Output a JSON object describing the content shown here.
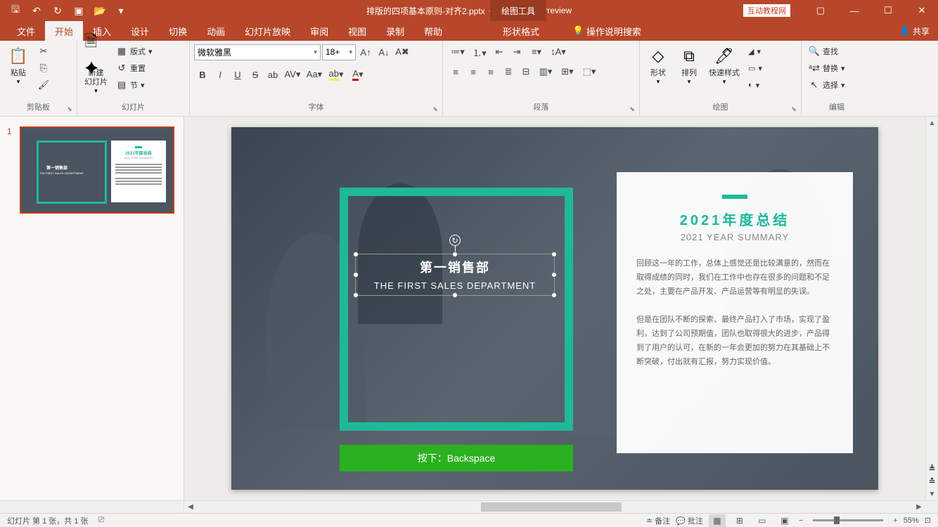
{
  "app": {
    "filename": "排版的四项基本原则-对齐2.pptx",
    "appname": "PowerPoint Preview",
    "context_tool": "绘图工具",
    "badge": "互动教程网"
  },
  "tabs": {
    "file": "文件",
    "home": "开始",
    "insert": "插入",
    "design": "设计",
    "transitions": "切换",
    "animations": "动画",
    "slideshow": "幻灯片放映",
    "review": "审阅",
    "view": "视图",
    "record": "录制",
    "help": "帮助",
    "format": "形状格式",
    "tellme": "操作说明搜索",
    "share": "共享"
  },
  "ribbon": {
    "clipboard": {
      "label": "剪贴板",
      "paste": "粘贴"
    },
    "slides": {
      "label": "幻灯片",
      "new": "新建\n幻灯片",
      "layout": "版式",
      "reset": "重置",
      "section": "节"
    },
    "font": {
      "label": "字体",
      "name": "微软雅黑",
      "size": "18+"
    },
    "paragraph": {
      "label": "段落"
    },
    "drawing": {
      "label": "绘图",
      "shapes": "形状",
      "arrange": "排列",
      "quickstyles": "快速样式"
    },
    "editing": {
      "label": "编辑",
      "find": "查找",
      "replace": "替换",
      "select": "选择"
    }
  },
  "slide": {
    "num": "1",
    "dept_cn": "第一销售部",
    "dept_en": "THE FIRST SALES DEPARTMENT",
    "card_title": "2021年度总结",
    "card_sub": "2021 YEAR SUMMARY",
    "para1": "回顾这一年的工作，总体上感觉还是比较满意的，然而在取得成绩的同时，我们在工作中也存在很多的问题和不足之处，主要在产品开发、产品运营等有明显的失误。",
    "para2": "但是在团队不断的探索、最终产品打入了市场，实现了盈利，达到了公司预期值，团队也取得很大的进步，产品得到了用户的认可，在新的一年会更加的努力在其基础上不断突破，付出就有汇报，努力实现价值。",
    "instruction": "按下：Backspace"
  },
  "status": {
    "slideinfo": "幻灯片 第 1 张，共 1 张",
    "notes": "备注",
    "comments": "批注",
    "zoom": "55%"
  }
}
